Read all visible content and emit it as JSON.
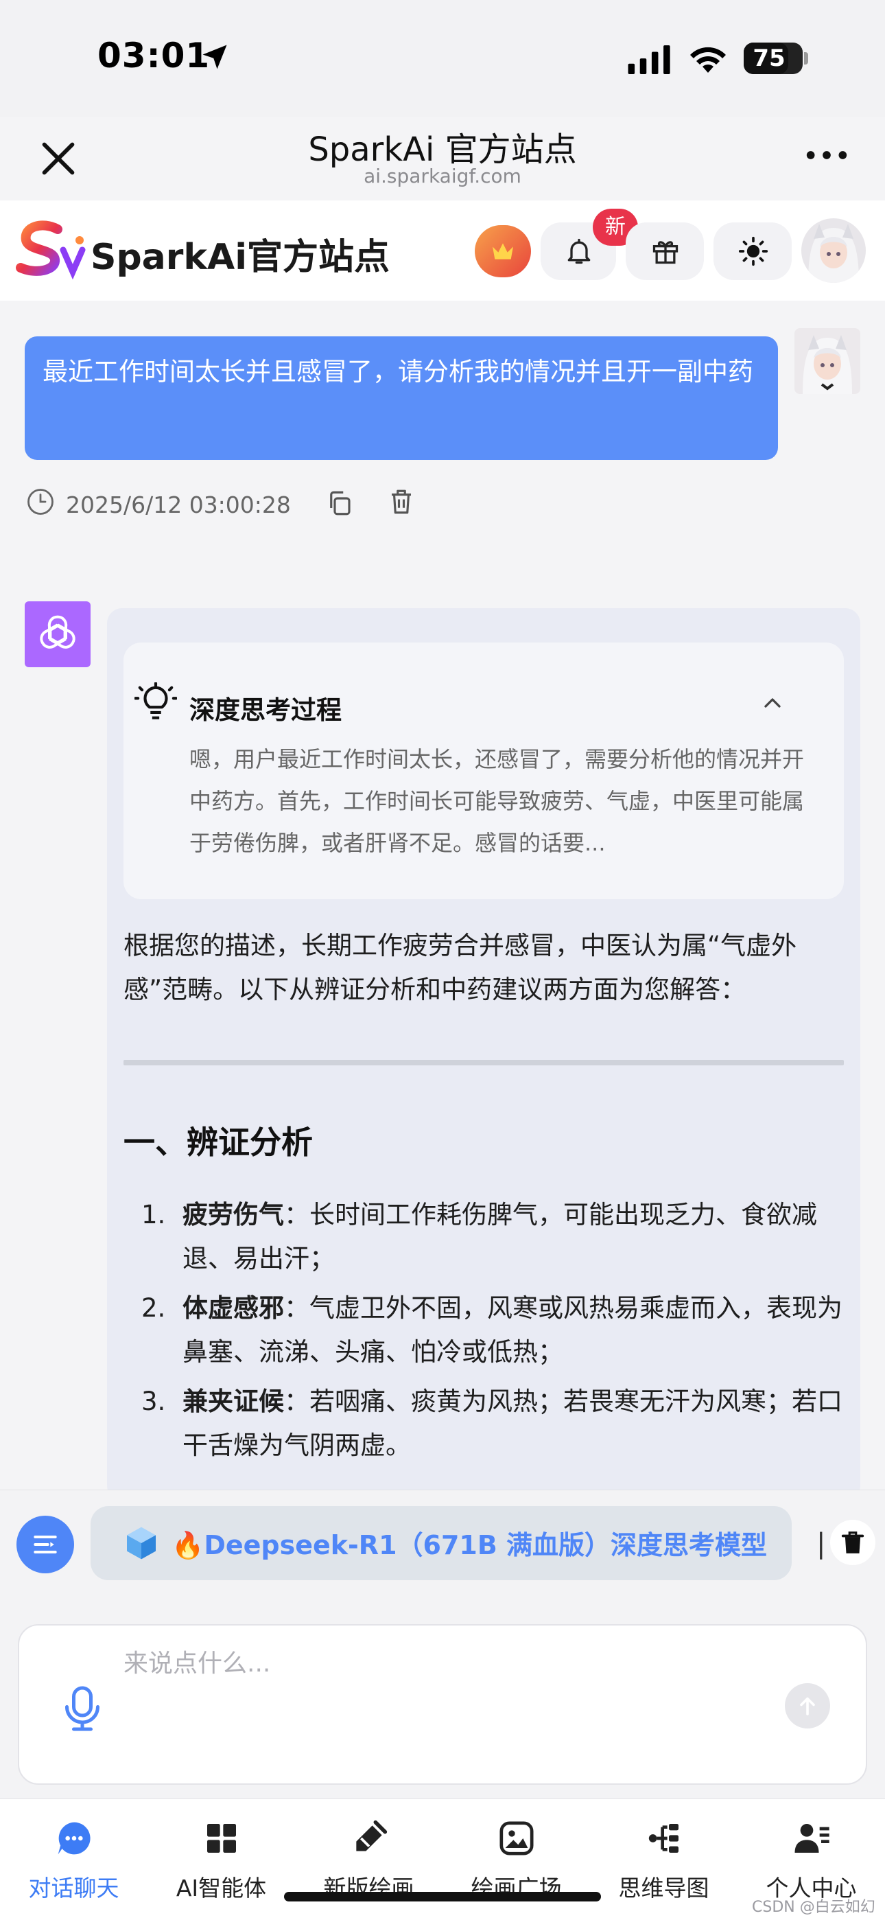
{
  "status_bar": {
    "time": "03:01",
    "battery": "75",
    "battery_level_percent": 75
  },
  "browser": {
    "title": "SparkAi 官方站点",
    "url": "ai.sparkaigf.com"
  },
  "app_header": {
    "name": "SparkAi官方站点",
    "new_badge": "新"
  },
  "user_message": {
    "text": "最近工作时间太长并且感冒了，请分析我的情况并且开一副中药",
    "timestamp": "2025/6/12 03:00:28"
  },
  "bot_message": {
    "thinking_title": "深度思考过程",
    "thinking_text": "嗯，用户最近工作时间太长，还感冒了，需要分析他的情况并开中药方。首先，工作时间长可能导致疲劳、气虚，中医里可能属于劳倦伤脾，或者肝肾不足。感冒的话要...",
    "intro": "根据您的描述，长期工作疲劳合并感冒，中医认为属“气虚外感”范畴。以下从辨证分析和中药建议两方面为您解答：",
    "section_heading": "一、辨证分析",
    "list": [
      {
        "num": "1.",
        "term": "疲劳伤气",
        "desc": "：长时间工作耗伤脾气，可能出现乏力、食欲减退、易出汗；"
      },
      {
        "num": "2.",
        "term": "体虚感邪",
        "desc": "：气虚卫外不固，风寒或风热易乘虚而入，表现为鼻塞、流涕、头痛、怕冷或低热；"
      },
      {
        "num": "3.",
        "term": "兼夹证候",
        "desc": "：若咽痛、痰黄为风热；若畏寒无汗为风寒；若口干舌燥为气阴两虚。"
      }
    ]
  },
  "model_selector": {
    "label": "🔥Deepseek-R1（671B 满血版）深度思考模型",
    "separator": "|"
  },
  "input": {
    "placeholder": "来说点什么..."
  },
  "tabs": [
    {
      "label": "对话聊天",
      "icon": "chat-bubble-icon",
      "active": true
    },
    {
      "label": "AI智能体",
      "icon": "grid-icon",
      "active": false
    },
    {
      "label": "新版绘画",
      "icon": "brush-icon",
      "active": false
    },
    {
      "label": "绘画广场",
      "icon": "image-icon",
      "active": false
    },
    {
      "label": "思维导图",
      "icon": "mindmap-icon",
      "active": false
    },
    {
      "label": "个人中心",
      "icon": "user-icon",
      "active": false
    }
  ],
  "watermark": "CSDN @白云如幻",
  "colors": {
    "accent": "#4f86f7",
    "user_bubble": "#5b8ff9",
    "badge": "#e8334a",
    "bot_avatar": "#ab68ff"
  }
}
